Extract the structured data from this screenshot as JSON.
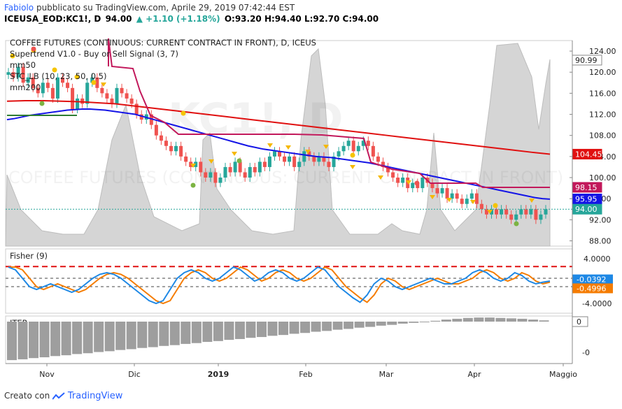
{
  "header": {
    "author": "Fabiolo",
    "published": "pubblicato su TradingView.com, Aprile 29, 2019 07:42:44 EST",
    "symbol": "ICEUSA_EOD:KC1!, D",
    "last": "94.00",
    "change": "▲ +1.10 (+1.18%)",
    "ohlc": "O:93.20 H:94.40 L:92.70 C:94.00"
  },
  "footer": {
    "created": "Creato con",
    "brand": "TradingView"
  },
  "colors": {
    "up": "#26a69a",
    "down": "#ef5350",
    "mm50": "#1414e6",
    "mm200": "#e01010",
    "supertrend": "#c2185b",
    "stc": "#555555"
  },
  "chart_data": [
    {
      "type": "candlestick",
      "title": "COFFEE FUTURES (CONTINUOUS: CURRENT CONTRACT IN FRONT), D, ICEUS",
      "watermark": "KC1!, D",
      "watermark_sub": "COFFEE FUTURES (CONTINUOUS: CURRENT CONTRACT IN FRONT)",
      "legend": [
        "Supertrend V1.0 - Buy or Sell Signal (3, 7)",
        "mm50",
        "STC_LB (10, 23, 50, 0.5)",
        "mm200"
      ],
      "y_ticks": [
        124,
        120,
        116,
        112,
        108,
        104,
        100,
        96,
        92,
        88
      ],
      "ylim": [
        87,
        126
      ],
      "x_ticks": [
        "Nov",
        "Dic",
        "2019",
        "Feb",
        "Mar",
        "Apr",
        "Maggio"
      ],
      "price_labels": [
        {
          "value": "90.99",
          "level": 121.5
        },
        {
          "value": "104.45",
          "level": 104.45
        },
        {
          "value": "98.15",
          "level": 98.15
        },
        {
          "value": "95.95",
          "level": 95.95
        },
        {
          "value": "94.00",
          "level": 94.0
        }
      ],
      "close": [
        120,
        119,
        121,
        118,
        119,
        117,
        116,
        118,
        117,
        115,
        119,
        118,
        117,
        113,
        115,
        114,
        118,
        119,
        117,
        116,
        115,
        114,
        117,
        116,
        115,
        114,
        112,
        111,
        112,
        110,
        108,
        107,
        106,
        105,
        106,
        104,
        103,
        102,
        103,
        101,
        100,
        101,
        99,
        100,
        102,
        101,
        103,
        101,
        100,
        102,
        101,
        103,
        102,
        104,
        105,
        104,
        103,
        104,
        102,
        103,
        105,
        104,
        103,
        104,
        103,
        102,
        104,
        105,
        106,
        107,
        105,
        106,
        107,
        106,
        104,
        103,
        102,
        101,
        100,
        99,
        100,
        98,
        99,
        98,
        100,
        99,
        98,
        97,
        98,
        96,
        97,
        96,
        95,
        96,
        97,
        95,
        94,
        93,
        94,
        93,
        94,
        93,
        92,
        93,
        94,
        93,
        94,
        92,
        93,
        94
      ],
      "mm50": [
        111,
        111.2,
        111.5,
        111.8,
        112,
        112.2,
        112.4,
        112.6,
        112.8,
        112.9,
        113,
        113,
        112.9,
        112.8,
        112.6,
        112.4,
        112.2,
        112,
        111.6,
        111.2,
        110.8,
        110.4,
        110,
        109.6,
        109.2,
        108.8,
        108.4,
        108,
        107.6,
        107.2,
        106.8,
        106.4,
        106,
        105.7,
        105.4,
        105.2,
        105,
        104.8,
        104.6,
        104.4,
        104.2,
        104,
        103.9,
        103.8,
        103.6,
        103.4,
        103.2,
        103,
        102.8,
        102.5,
        102.2,
        101.9,
        101.6,
        101.3,
        101,
        100.7,
        100.4,
        100.1,
        99.8,
        99.5,
        99.2,
        98.9,
        98.6,
        98.3,
        98,
        97.7,
        97.4,
        97.1,
        96.8,
        96.5,
        96.2,
        96,
        95.9
      ],
      "mm200": [
        114.5,
        114.6,
        114.6,
        114.5,
        114.4,
        114.2,
        114,
        113.6,
        113.2,
        112.8,
        112.4,
        112,
        111.6,
        111.2,
        110.8,
        110.4,
        110,
        109.6,
        109.2,
        108.8,
        108.4,
        108,
        107.6,
        107.2,
        106.8,
        106.4,
        106,
        105.6,
        105.2,
        104.8,
        104.45
      ],
      "series": [
        {
          "name": "mm50",
          "last": 95.95
        },
        {
          "name": "mm200",
          "last": 104.45
        },
        {
          "name": "Supertrend",
          "last": 98.15
        },
        {
          "name": "STC_LB",
          "last": 90.99
        }
      ]
    },
    {
      "type": "line",
      "title": "Fisher (9)",
      "y_ticks": [
        "4.0000",
        "-4.0000"
      ],
      "levels": [
        2.6,
        0.5,
        -1.0
      ],
      "series": [
        {
          "name": "Fisher",
          "last": "-0.0392",
          "color": "#1e88e5"
        },
        {
          "name": "Trigger",
          "last": "-0.4996",
          "color": "#f57c00"
        }
      ],
      "values": [
        2.5,
        2.0,
        0.5,
        -1.0,
        -1.5,
        -1.0,
        -0.5,
        -1.0,
        -1.5,
        -2.0,
        -1.5,
        -0.5,
        0.5,
        1.2,
        1.5,
        1.2,
        0.5,
        -0.5,
        -1.5,
        -2.5,
        -3.5,
        -4.0,
        -3.5,
        -1.5,
        0.5,
        1.5,
        2.0,
        1.5,
        0.5,
        0.0,
        0.5,
        1.5,
        2.5,
        2.0,
        1.0,
        0.0,
        0.5,
        1.5,
        2.0,
        1.5,
        0.5,
        0.0,
        0.5,
        1.5,
        2.5,
        2.0,
        0.5,
        -1.0,
        -2.0,
        -3.0,
        -3.8,
        -2.5,
        -0.5,
        0.5,
        0.0,
        -1.0,
        -1.5,
        -1.0,
        -0.5,
        0.0,
        0.5,
        0.0,
        -0.5,
        -0.5,
        0.0,
        0.5,
        1.5,
        2.0,
        1.5,
        0.5,
        0.0,
        0.5,
        1.5,
        1.0,
        0.0,
        -0.5,
        -0.2,
        0.0
      ]
    },
    {
      "type": "bar",
      "title": "ITER",
      "y_ticks": [
        "0",
        "-0"
      ],
      "values": [
        -0.95,
        -0.93,
        -0.9,
        -0.88,
        -0.85,
        -0.83,
        -0.8,
        -0.78,
        -0.75,
        -0.73,
        -0.7,
        -0.68,
        -0.65,
        -0.63,
        -0.6,
        -0.58,
        -0.55,
        -0.53,
        -0.5,
        -0.48,
        -0.45,
        -0.43,
        -0.4,
        -0.38,
        -0.35,
        -0.33,
        -0.3,
        -0.28,
        -0.25,
        -0.23,
        -0.2,
        -0.18,
        -0.15,
        -0.13,
        -0.1,
        -0.08,
        -0.05,
        -0.03,
        0.0,
        0.02,
        0.05,
        0.07,
        0.09,
        0.1,
        0.1,
        0.09,
        0.08,
        0.07,
        0.05,
        0.03
      ]
    }
  ]
}
